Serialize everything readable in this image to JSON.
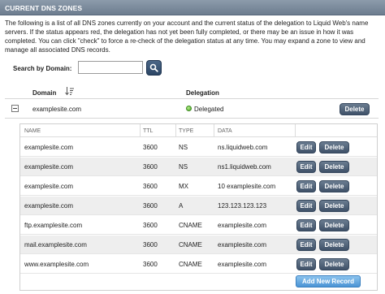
{
  "header": {
    "title": "CURRENT DNS ZONES"
  },
  "description": "The following is a list of all DNS zones currently on your account and the current status of the delegation to Liquid Web's name servers. If the status appears red, the delegation has not yet been fully completed, or there may be an issue in how it was completed. You can click \"check\" to force a re-check of the delegation status at any time. You may expand a zone to view and manage all associated DNS records.",
  "search": {
    "label": "Search by Domain:",
    "value": "",
    "icon": "magnifier-icon"
  },
  "columns": {
    "domain": "Domain",
    "delegation": "Delegation"
  },
  "zone": {
    "domain": "examplesite.com",
    "status": "Delegated",
    "status_color": "#4ba62a",
    "delete_label": "Delete"
  },
  "records": {
    "headers": {
      "name": "NAME",
      "ttl": "TTL",
      "type": "TYPE",
      "data": "DATA"
    },
    "edit_label": "Edit",
    "delete_label": "Delete",
    "rows": [
      {
        "name": "examplesite.com",
        "ttl": "3600",
        "type": "NS",
        "data": "ns.liquidweb.com"
      },
      {
        "name": "examplesite.com",
        "ttl": "3600",
        "type": "NS",
        "data": "ns1.liquidweb.com"
      },
      {
        "name": "examplesite.com",
        "ttl": "3600",
        "type": "MX",
        "data": "10 examplesite.com"
      },
      {
        "name": "examplesite.com",
        "ttl": "3600",
        "type": "A",
        "data": "123.123.123.123"
      },
      {
        "name": "ftp.examplesite.com",
        "ttl": "3600",
        "type": "CNAME",
        "data": "examplesite.com"
      },
      {
        "name": "mail.examplesite.com",
        "ttl": "3600",
        "type": "CNAME",
        "data": "examplesite.com"
      },
      {
        "name": "www.examplesite.com",
        "ttl": "3600",
        "type": "CNAME",
        "data": "examplesite.com"
      }
    ],
    "add_label": "Add New Record"
  },
  "colors": {
    "header_bar": "#7a8a9c",
    "button": "#4a5c72",
    "add_button": "#5aa2dd",
    "row_alt": "#eeeeee"
  }
}
